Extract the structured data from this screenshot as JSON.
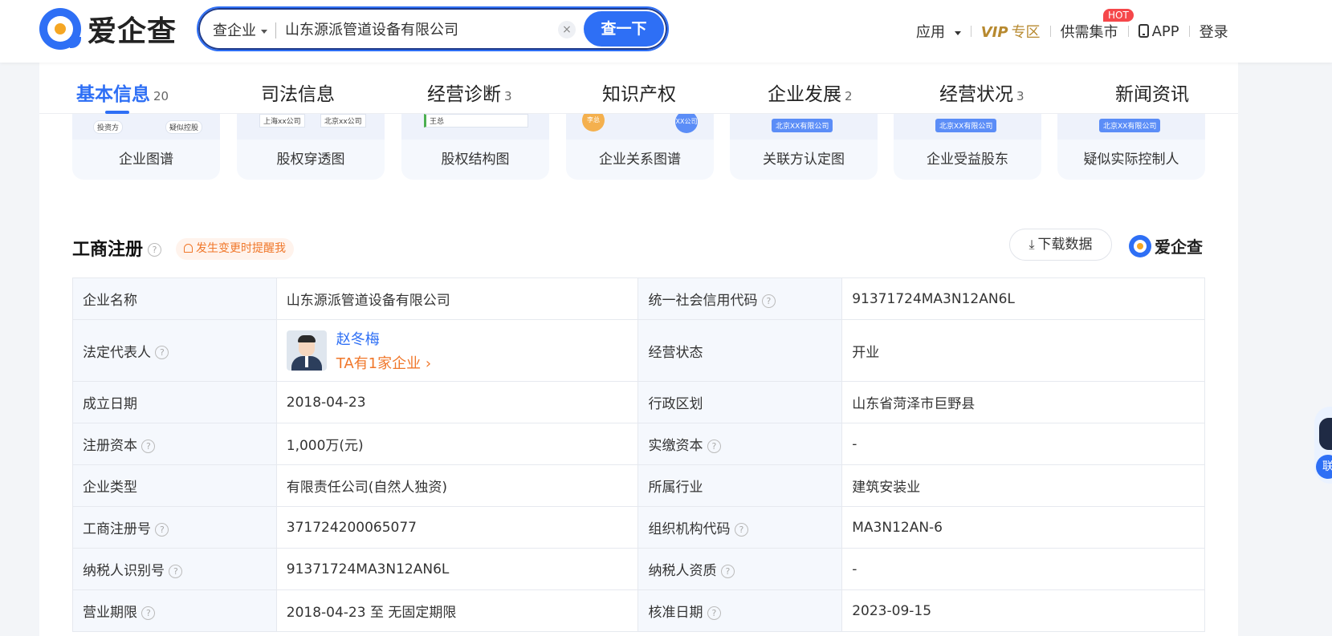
{
  "header": {
    "logo_text": "爱企查",
    "search_type": "查企业",
    "search_value": "山东源派管道设备有限公司",
    "search_button": "查一下",
    "nav": {
      "apps": "应用",
      "vip": "VIP",
      "vip_sub": "专区",
      "supply": "供需集市",
      "hot": "HOT",
      "app": "APP",
      "login": "登录"
    }
  },
  "tabs": [
    {
      "label": "基本信息",
      "count": "20"
    },
    {
      "label": "司法信息",
      "count": ""
    },
    {
      "label": "经营诊断",
      "count": "3"
    },
    {
      "label": "知识产权",
      "count": ""
    },
    {
      "label": "企业发展",
      "count": "2"
    },
    {
      "label": "经营状况",
      "count": "3"
    },
    {
      "label": "新闻资讯",
      "count": ""
    }
  ],
  "graph_cards": [
    {
      "label": "企业图谱",
      "thumb": [
        "投资方",
        "疑似控股"
      ]
    },
    {
      "label": "股权穿透图",
      "thumb": [
        "上海xx公司",
        "北京xx公司"
      ]
    },
    {
      "label": "股权结构图",
      "thumb": [
        "王总"
      ]
    },
    {
      "label": "企业关系图谱",
      "thumb": [
        "李总",
        "XX公司"
      ]
    },
    {
      "label": "关联方认定图",
      "thumb": [
        "北京XX有限公司"
      ]
    },
    {
      "label": "企业受益股东",
      "thumb": [
        "北京XX有限公司"
      ]
    },
    {
      "label": "疑似实际控制人",
      "thumb": [
        "北京XX有限公司"
      ]
    }
  ],
  "section": {
    "title": "工商注册",
    "remind": "发生变更时提醒我",
    "download": "下载数据",
    "brand": "爱企查"
  },
  "registration": {
    "rows": [
      {
        "k1": "企业名称",
        "v1": "山东源派管道设备有限公司",
        "k2": "统一社会信用代码",
        "v2": "91371724MA3N12AN6L"
      },
      {
        "k1": "法定代表人",
        "v1": "赵冬梅",
        "v1_sub": "TA有1家企业",
        "k2": "经营状态",
        "v2": "开业"
      },
      {
        "k1": "成立日期",
        "v1": "2018-04-23",
        "k2": "行政区划",
        "v2": "山东省菏泽市巨野县"
      },
      {
        "k1": "注册资本",
        "v1": "1,000万(元)",
        "k2": "实缴资本",
        "v2": "-"
      },
      {
        "k1": "企业类型",
        "v1": "有限责任公司(自然人独资)",
        "k2": "所属行业",
        "v2": "建筑安装业"
      },
      {
        "k1": "工商注册号",
        "v1": "371724200065077",
        "k2": "组织机构代码",
        "v2": "MA3N12AN-6"
      },
      {
        "k1": "纳税人识别号",
        "v1": "91371724MA3N12AN6L",
        "k2": "纳税人资质",
        "v2": "-"
      },
      {
        "k1": "营业期限",
        "v1": "2018-04-23 至 无固定期限",
        "k2": "核准日期",
        "v2": "2023-09-15"
      }
    ]
  },
  "side_widget": {
    "badge": "联"
  },
  "colors": {
    "accent": "#2e6ff5",
    "orange": "#f0772a",
    "vip_gold": "#b7892f",
    "hot_red": "#f5474a"
  }
}
